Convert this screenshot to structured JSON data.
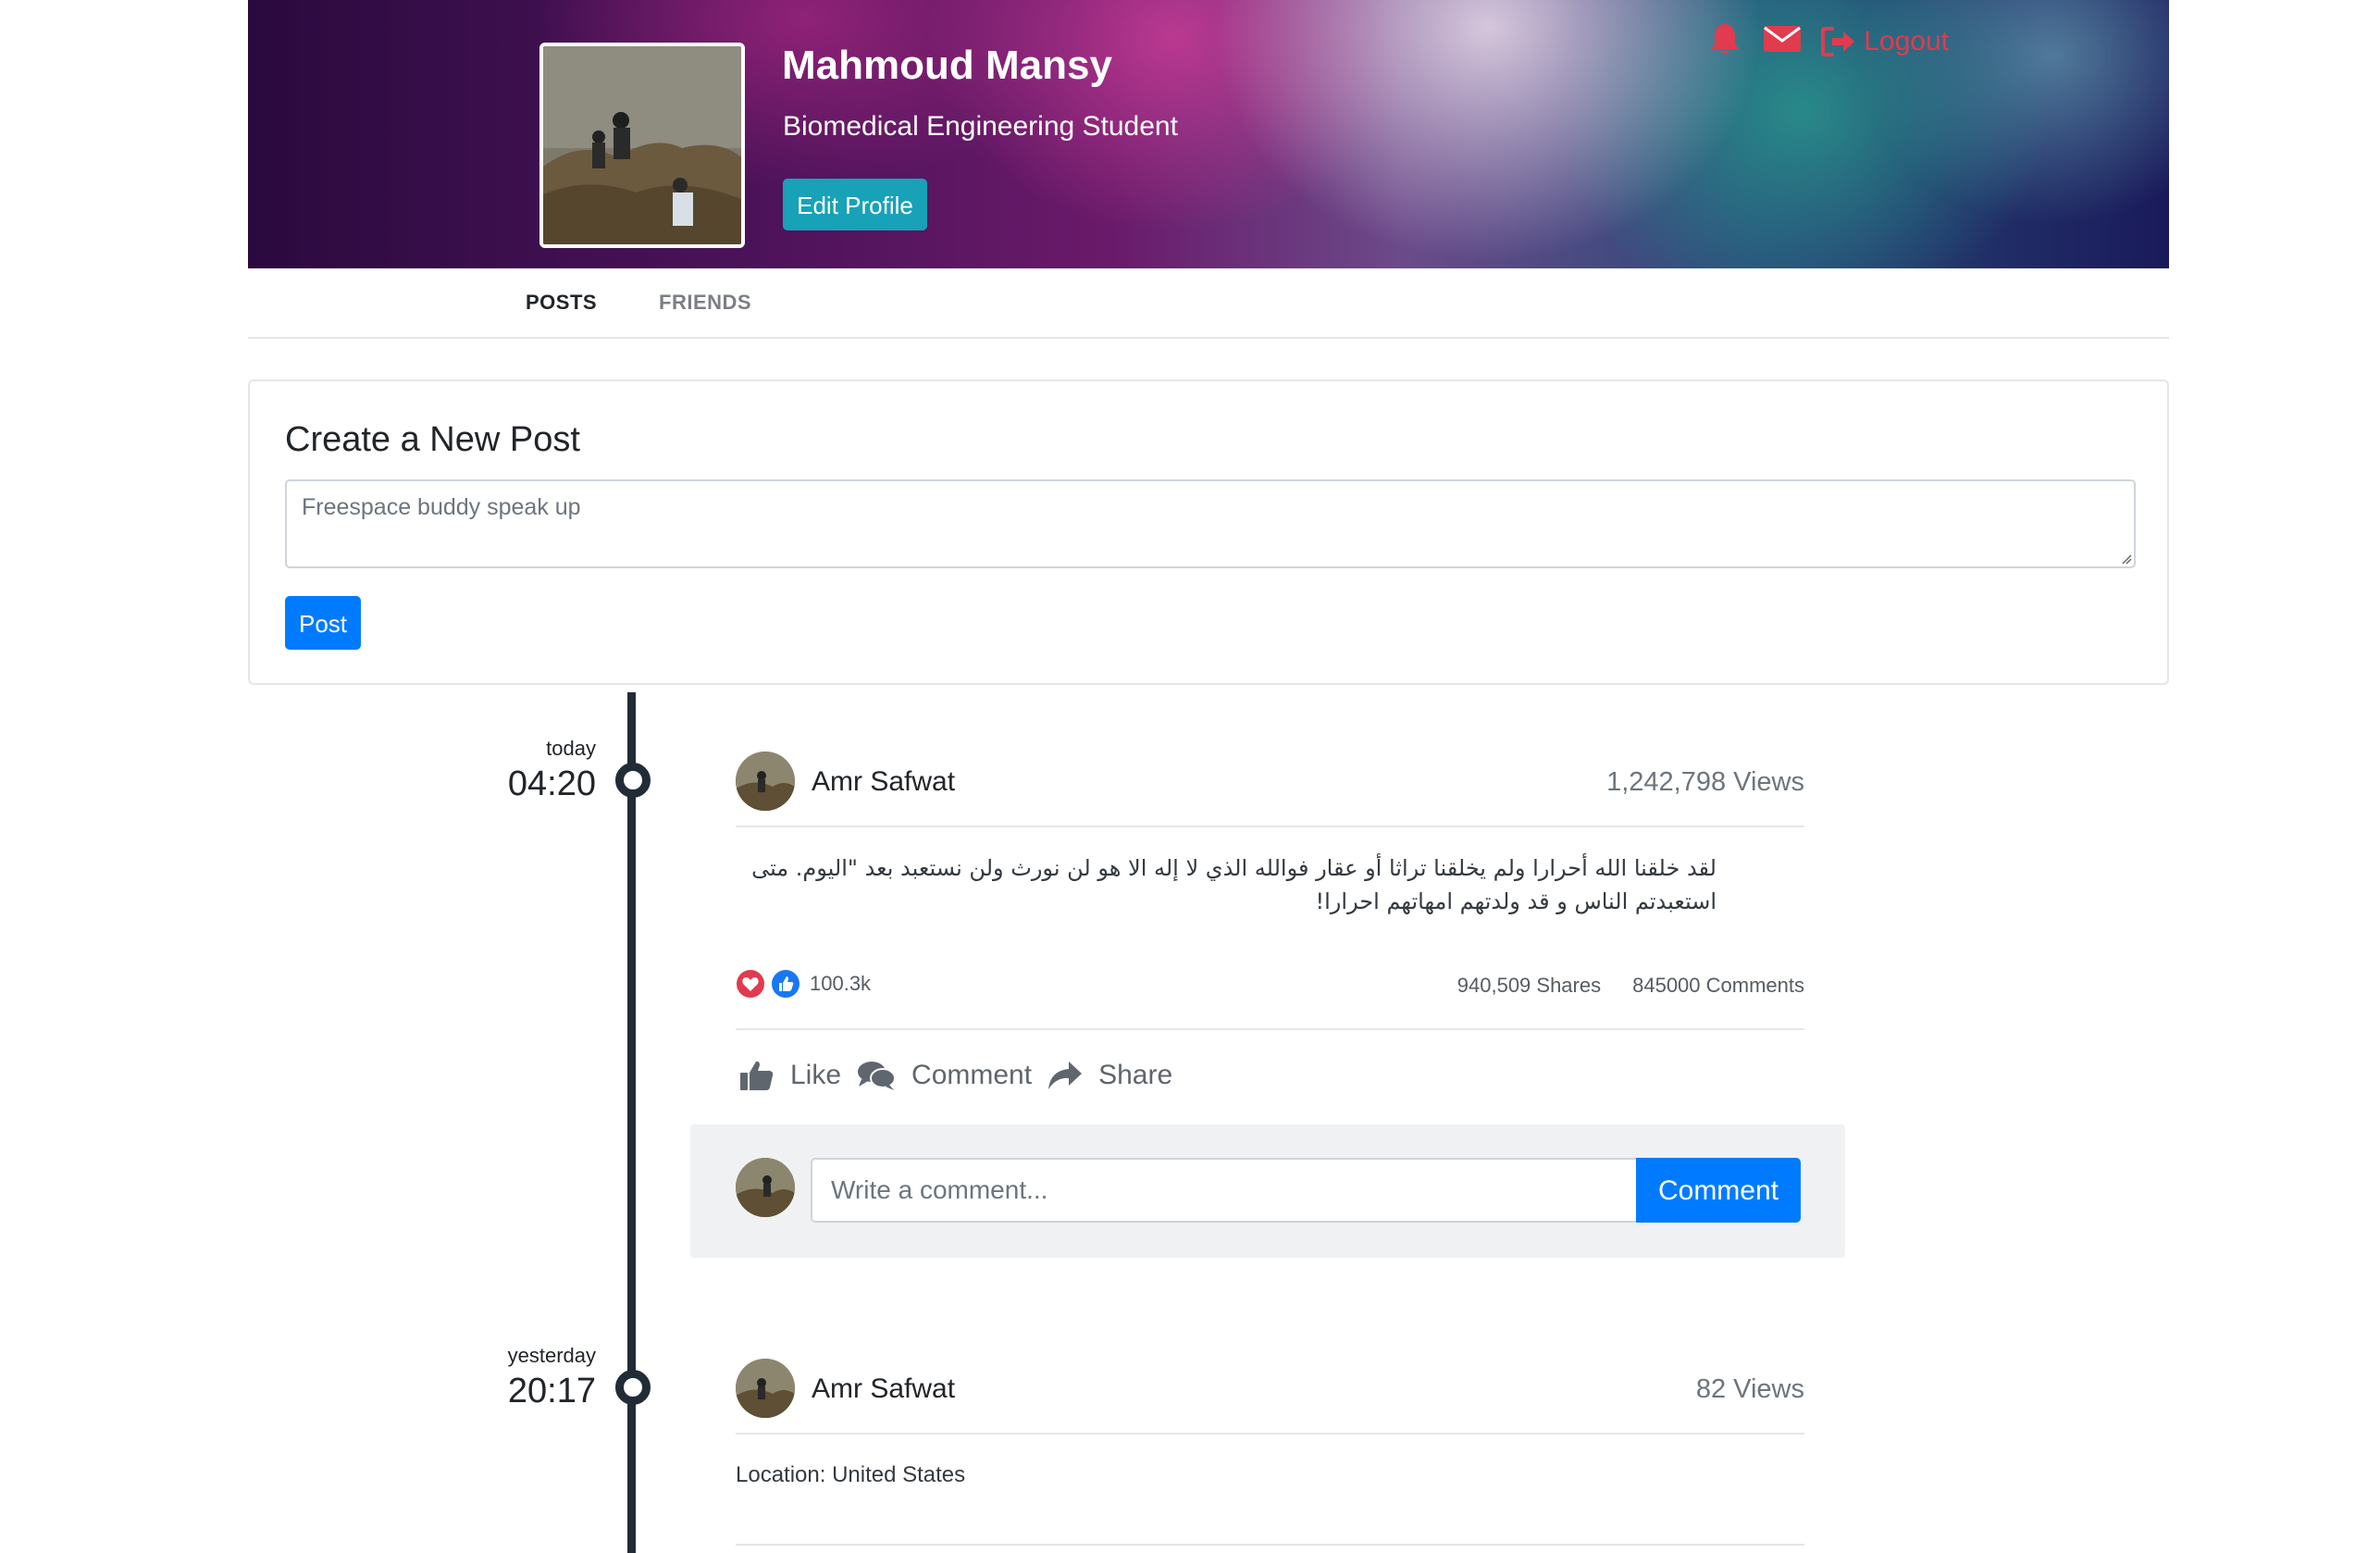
{
  "header": {
    "name": "Mahmoud Mansy",
    "subtitle": "Biomedical Engineering Student",
    "edit_profile_label": "Edit Profile",
    "logout_label": "Logout",
    "icons": [
      "bell-icon",
      "envelope-icon",
      "logout-icon"
    ],
    "accent_color": "#e03b4f"
  },
  "tabs": [
    {
      "label": "POSTS",
      "active": true
    },
    {
      "label": "FRIENDS",
      "active": false
    }
  ],
  "create_post": {
    "title": "Create a New Post",
    "placeholder": "Freespace buddy speak up",
    "value": "",
    "button_label": "Post"
  },
  "posts": [
    {
      "day": "today",
      "time": "04:20",
      "author": "Amr Safwat",
      "views": "1,242,798 Views",
      "text": "لقد خلقنا الله أحرارا ولم يخلقنا تراثا أو عقار فوالله الذي لا إله الا هو لن نورث ولن نستعبد بعد \"اليوم. متى استعبدتم الناس و قد ولدتهم امهاتهم احرارا!",
      "reactions_count": "100.3k",
      "shares": "940,509 Shares",
      "comments": "845000 Comments",
      "actions": {
        "like": "Like",
        "comment": "Comment",
        "share": "Share"
      },
      "comment_placeholder": "Write a comment...",
      "comment_button": "Comment"
    },
    {
      "day": "yesterday",
      "time": "20:17",
      "author": "Amr Safwat",
      "views": "82 Views",
      "location": "Location: United States"
    }
  ],
  "colors": {
    "primary": "#007bff",
    "info": "#17a2b8",
    "timeline": "#222c36",
    "love": "#e03b4f",
    "like": "#1877f2"
  }
}
